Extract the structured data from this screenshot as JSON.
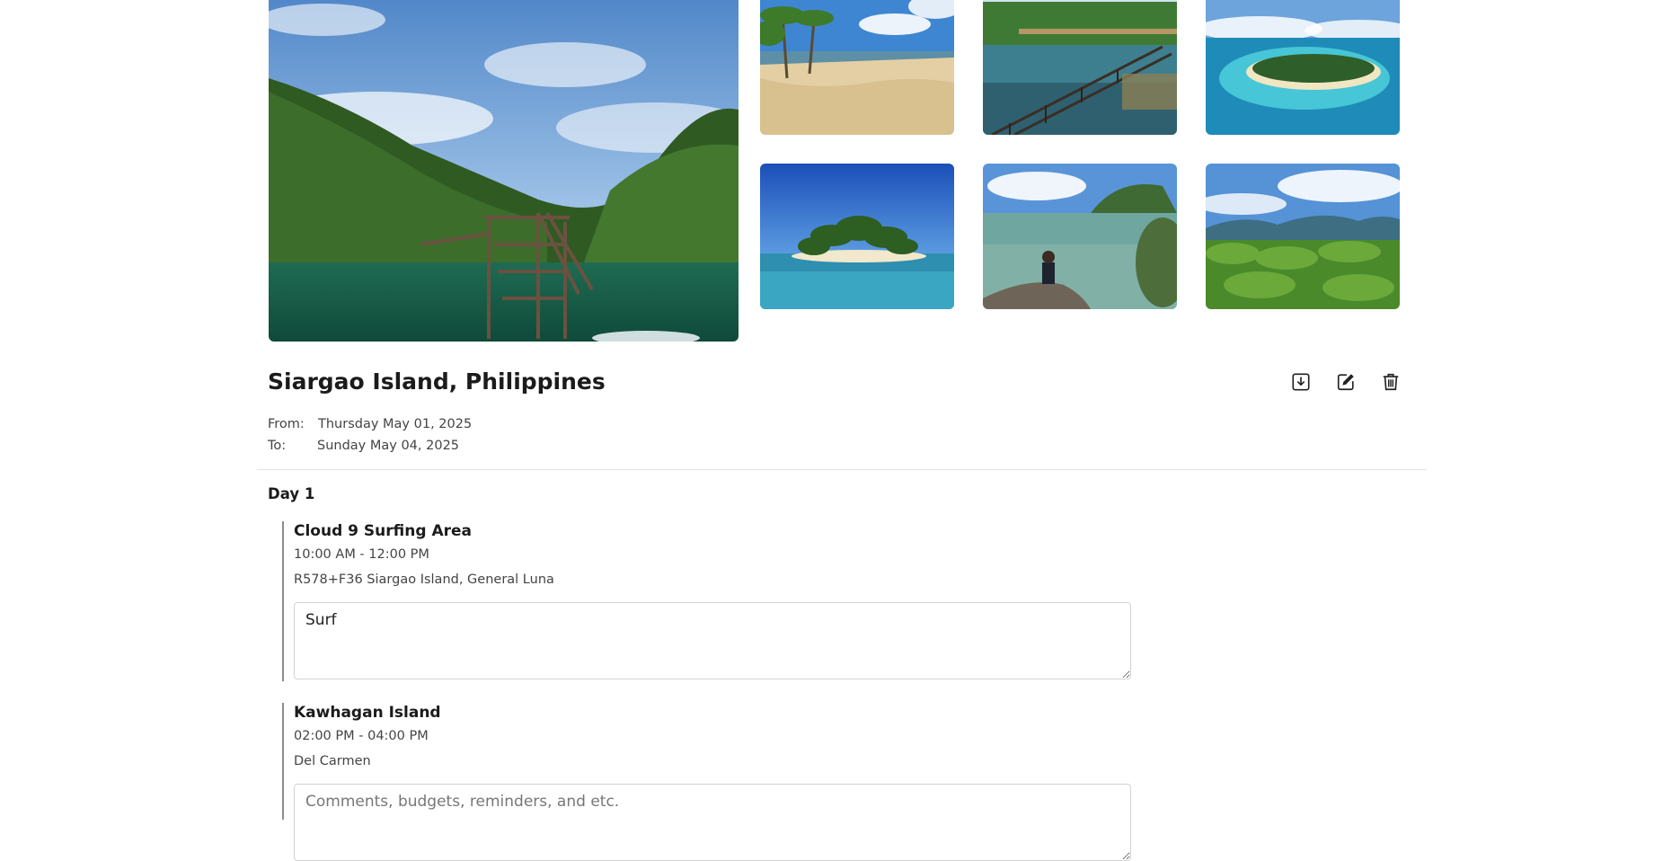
{
  "gallery": {
    "photos": [
      {
        "alt": "Lagoon with wooden diving tower and forested cliffs"
      },
      {
        "alt": "Sandy beach with palm trees"
      },
      {
        "alt": "Boardwalk pier over water"
      },
      {
        "alt": "Aerial view of island with reef"
      },
      {
        "alt": "Small island with palm trees on blue sea"
      },
      {
        "alt": "Person sitting on rock by clear water"
      },
      {
        "alt": "Palm forest with mountains and clouds"
      }
    ]
  },
  "trip": {
    "title": "Siargao Island, Philippines",
    "from_label": "From:",
    "from_date": "Thursday May 01, 2025",
    "to_label": "To:",
    "to_date": "Sunday May 04, 2025"
  },
  "actions": {
    "icons": [
      "download-icon",
      "edit-icon",
      "trash-icon"
    ]
  },
  "itinerary": {
    "days": [
      {
        "label": "Day 1",
        "activities": [
          {
            "name": "Cloud 9 Surfing Area",
            "time": "10:00 AM - 12:00 PM",
            "place": "R578+F36 Siargao Island, General Luna",
            "comment": "Surf",
            "placeholder": "Comments, budgets, reminders, and etc."
          },
          {
            "name": "Kawhagan Island",
            "time": "02:00 PM - 04:00 PM",
            "place": "Del Carmen",
            "comment": "",
            "placeholder": "Comments, budgets, reminders, and etc."
          }
        ]
      }
    ]
  }
}
